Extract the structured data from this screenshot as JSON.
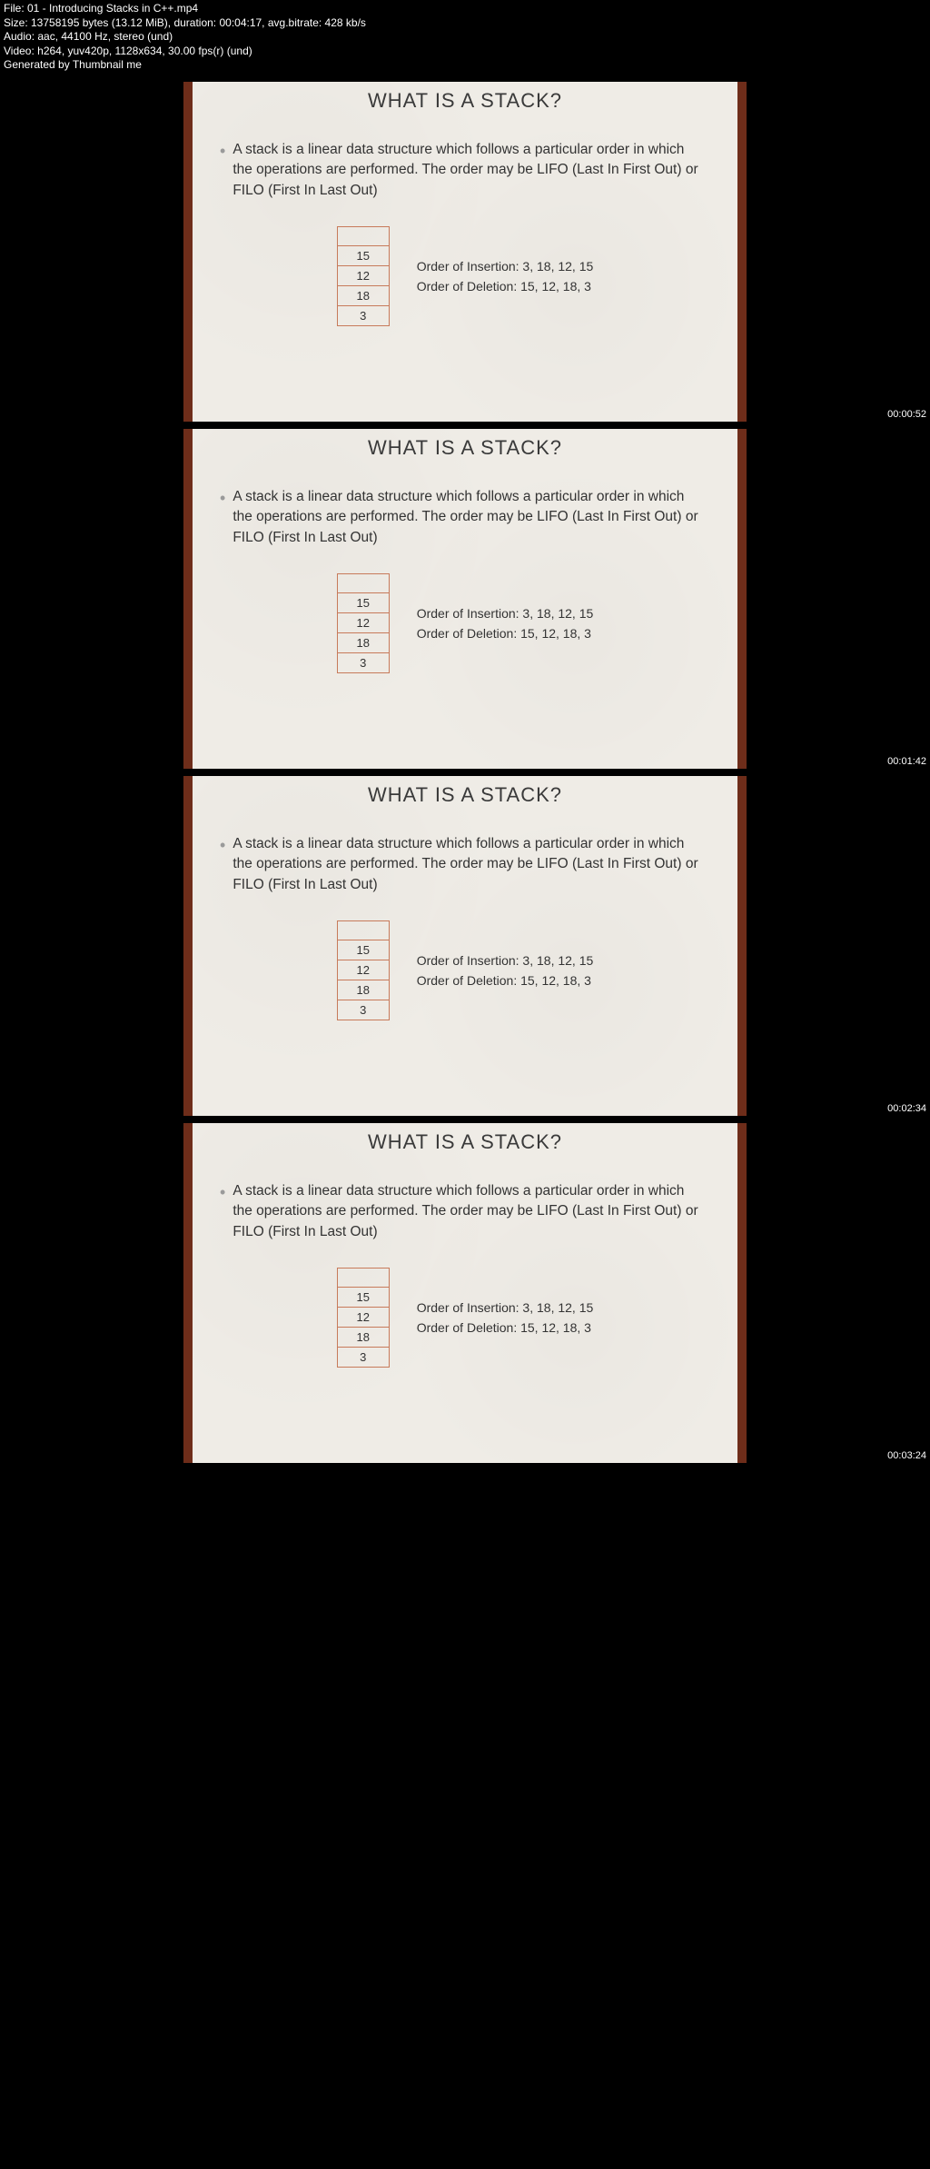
{
  "meta": {
    "file": "File: 01 - Introducing Stacks in C++.mp4",
    "size": "Size: 13758195 bytes (13.12 MiB), duration: 00:04:17, avg.bitrate: 428 kb/s",
    "audio": "Audio: aac, 44100 Hz, stereo (und)",
    "video": "Video: h264, yuv420p, 1128x634, 30.00 fps(r) (und)",
    "gen": "Generated by Thumbnail me"
  },
  "slide": {
    "title": "WHAT IS A STACK?",
    "bullet": "A stack is a linear data structure which follows a particular order in which the operations are performed. The order may be LIFO (Last In First Out) or FILO (First In Last Out)",
    "stack": [
      "",
      "15",
      "12",
      "18",
      "3"
    ],
    "insertion": "Order of Insertion: 3, 18, 12, 15",
    "deletion": "Order of Deletion: 15, 12, 18, 3"
  },
  "timestamps": [
    "00:00:52",
    "00:01:42",
    "00:02:34",
    "00:03:24"
  ]
}
